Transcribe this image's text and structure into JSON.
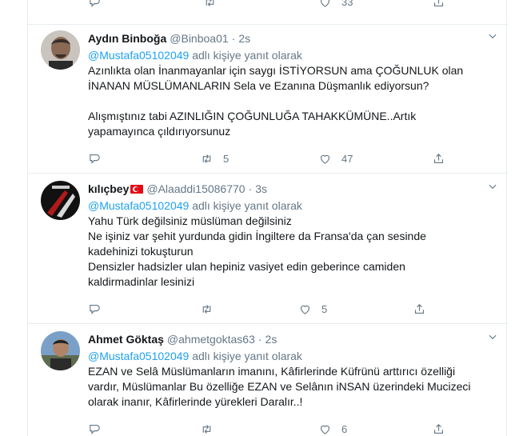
{
  "top_partial": {
    "retweets": "",
    "likes": "33"
  },
  "tweets": [
    {
      "name": "Aydın Binboğa",
      "handle": "@Binboa01",
      "time": "2s",
      "reply_mention": "@Mustafa05102049",
      "reply_suffix": "adlı kişiye yanıt olarak",
      "text": "Azınlıkta olan İnanmayanlar için saygı İSTİYORSUN ama ÇOĞUNLUK olan\nİNANAN MÜSLÜMANLARIN Sela ve Ezanına Düşmanlık ediyorsun?\n\nAlışmıştınız tabi AZINLIĞIN ÇOĞUNLUĞA TAHAKKÜMÜNE..Artık\nyapamayınca çıldırıyorsunuz",
      "replies": "",
      "retweets": "5",
      "likes": "47"
    },
    {
      "name": "kılıçbey",
      "handle": "@Alaaddi15086770",
      "time": "3s",
      "reply_mention": "@Mustafa05102049",
      "reply_suffix": "adlı kişiye yanıt olarak",
      "text": "Yahu Türk değilsiniz müslüman değilsiniz\nNe işiniz var şehit yurdunda gidin İngiltere da Fransa'da çan sesinde\nkadehinizi tokuşturun\nDensizler hadsizler ulan hepiniz vasiyet edin geberince camiden\nkaldirmadinlar lesinizi",
      "replies": "",
      "retweets": "",
      "likes": "5"
    },
    {
      "name": "Ahmet Göktaş",
      "handle": "@ahmetgoktas63",
      "time": "2s",
      "reply_mention": "@Mustafa05102049",
      "reply_suffix": "adlı kişiye yanıt olarak",
      "text": "EZAN ve Selâ Müslümanların imanını, Kâfirlerinde Küfrünü arttırıcı özelliği\nvardır, Müslümanlar Bu özelliğe EZAN ve Selânın iNSAN üzerindeki Mucizeci\nolarak inanır, Kâfirlerinde yürekleri Daralır..!",
      "replies": "",
      "retweets": "",
      "likes": "6"
    }
  ],
  "colors": {
    "text": "#14171a",
    "secondary": "#657786",
    "link": "#1da1f2",
    "border": "#e6ecf0"
  }
}
